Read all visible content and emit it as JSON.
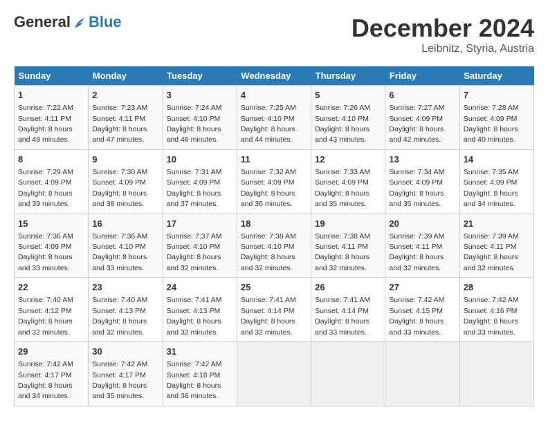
{
  "header": {
    "logo_line1": "General",
    "logo_line2": "Blue",
    "month": "December 2024",
    "location": "Leibnitz, Styria, Austria"
  },
  "weekdays": [
    "Sunday",
    "Monday",
    "Tuesday",
    "Wednesday",
    "Thursday",
    "Friday",
    "Saturday"
  ],
  "weeks": [
    [
      {
        "day": "1",
        "sunrise": "7:22 AM",
        "sunset": "4:11 PM",
        "daylight": "8 hours and 49 minutes."
      },
      {
        "day": "2",
        "sunrise": "7:23 AM",
        "sunset": "4:11 PM",
        "daylight": "8 hours and 47 minutes."
      },
      {
        "day": "3",
        "sunrise": "7:24 AM",
        "sunset": "4:10 PM",
        "daylight": "8 hours and 46 minutes."
      },
      {
        "day": "4",
        "sunrise": "7:25 AM",
        "sunset": "4:10 PM",
        "daylight": "8 hours and 44 minutes."
      },
      {
        "day": "5",
        "sunrise": "7:26 AM",
        "sunset": "4:10 PM",
        "daylight": "8 hours and 43 minutes."
      },
      {
        "day": "6",
        "sunrise": "7:27 AM",
        "sunset": "4:09 PM",
        "daylight": "8 hours and 42 minutes."
      },
      {
        "day": "7",
        "sunrise": "7:28 AM",
        "sunset": "4:09 PM",
        "daylight": "8 hours and 40 minutes."
      }
    ],
    [
      {
        "day": "8",
        "sunrise": "7:29 AM",
        "sunset": "4:09 PM",
        "daylight": "8 hours and 39 minutes."
      },
      {
        "day": "9",
        "sunrise": "7:30 AM",
        "sunset": "4:09 PM",
        "daylight": "8 hours and 38 minutes."
      },
      {
        "day": "10",
        "sunrise": "7:31 AM",
        "sunset": "4:09 PM",
        "daylight": "8 hours and 37 minutes."
      },
      {
        "day": "11",
        "sunrise": "7:32 AM",
        "sunset": "4:09 PM",
        "daylight": "8 hours and 36 minutes."
      },
      {
        "day": "12",
        "sunrise": "7:33 AM",
        "sunset": "4:09 PM",
        "daylight": "8 hours and 35 minutes."
      },
      {
        "day": "13",
        "sunrise": "7:34 AM",
        "sunset": "4:09 PM",
        "daylight": "8 hours and 35 minutes."
      },
      {
        "day": "14",
        "sunrise": "7:35 AM",
        "sunset": "4:09 PM",
        "daylight": "8 hours and 34 minutes."
      }
    ],
    [
      {
        "day": "15",
        "sunrise": "7:36 AM",
        "sunset": "4:09 PM",
        "daylight": "8 hours and 33 minutes."
      },
      {
        "day": "16",
        "sunrise": "7:36 AM",
        "sunset": "4:10 PM",
        "daylight": "8 hours and 33 minutes."
      },
      {
        "day": "17",
        "sunrise": "7:37 AM",
        "sunset": "4:10 PM",
        "daylight": "8 hours and 32 minutes."
      },
      {
        "day": "18",
        "sunrise": "7:38 AM",
        "sunset": "4:10 PM",
        "daylight": "8 hours and 32 minutes."
      },
      {
        "day": "19",
        "sunrise": "7:38 AM",
        "sunset": "4:11 PM",
        "daylight": "8 hours and 32 minutes."
      },
      {
        "day": "20",
        "sunrise": "7:39 AM",
        "sunset": "4:11 PM",
        "daylight": "8 hours and 32 minutes."
      },
      {
        "day": "21",
        "sunrise": "7:39 AM",
        "sunset": "4:11 PM",
        "daylight": "8 hours and 32 minutes."
      }
    ],
    [
      {
        "day": "22",
        "sunrise": "7:40 AM",
        "sunset": "4:12 PM",
        "daylight": "8 hours and 32 minutes."
      },
      {
        "day": "23",
        "sunrise": "7:40 AM",
        "sunset": "4:13 PM",
        "daylight": "8 hours and 32 minutes."
      },
      {
        "day": "24",
        "sunrise": "7:41 AM",
        "sunset": "4:13 PM",
        "daylight": "8 hours and 32 minutes."
      },
      {
        "day": "25",
        "sunrise": "7:41 AM",
        "sunset": "4:14 PM",
        "daylight": "8 hours and 32 minutes."
      },
      {
        "day": "26",
        "sunrise": "7:41 AM",
        "sunset": "4:14 PM",
        "daylight": "8 hours and 33 minutes."
      },
      {
        "day": "27",
        "sunrise": "7:42 AM",
        "sunset": "4:15 PM",
        "daylight": "8 hours and 33 minutes."
      },
      {
        "day": "28",
        "sunrise": "7:42 AM",
        "sunset": "4:16 PM",
        "daylight": "8 hours and 33 minutes."
      }
    ],
    [
      {
        "day": "29",
        "sunrise": "7:42 AM",
        "sunset": "4:17 PM",
        "daylight": "8 hours and 34 minutes."
      },
      {
        "day": "30",
        "sunrise": "7:42 AM",
        "sunset": "4:17 PM",
        "daylight": "8 hours and 35 minutes."
      },
      {
        "day": "31",
        "sunrise": "7:42 AM",
        "sunset": "4:18 PM",
        "daylight": "8 hours and 36 minutes."
      },
      null,
      null,
      null,
      null
    ]
  ]
}
